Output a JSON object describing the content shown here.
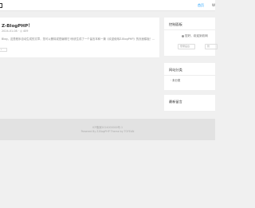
{
  "nav": {
    "home_label": "首页",
    "next_label": "W"
  },
  "post": {
    "title": "Z-BlogPHP！",
    "meta": "2024-01-08  ·  ◎ 409",
    "excerpt": "Blog，这是程序自动生成的文章，您可以删除或是编辑它!系统生成了一个留言本和一篇《欢迎使用Z-BlogPHP》的页面模板！...",
    "more_label": "›"
  },
  "control_panel": {
    "title": "控制面板",
    "welcome": "您好，欢迎到访网",
    "login_label": "登录后台",
    "admin_label": "管"
  },
  "category_panel": {
    "title": "网站分类",
    "items": [
      "· 未分类"
    ]
  },
  "comments_panel": {
    "title": "最新留言"
  },
  "footer": {
    "line1": "ICP备案2024000000号-1",
    "line2": "Powered By Z-BlogPHP  Theme by TOYEAN"
  }
}
